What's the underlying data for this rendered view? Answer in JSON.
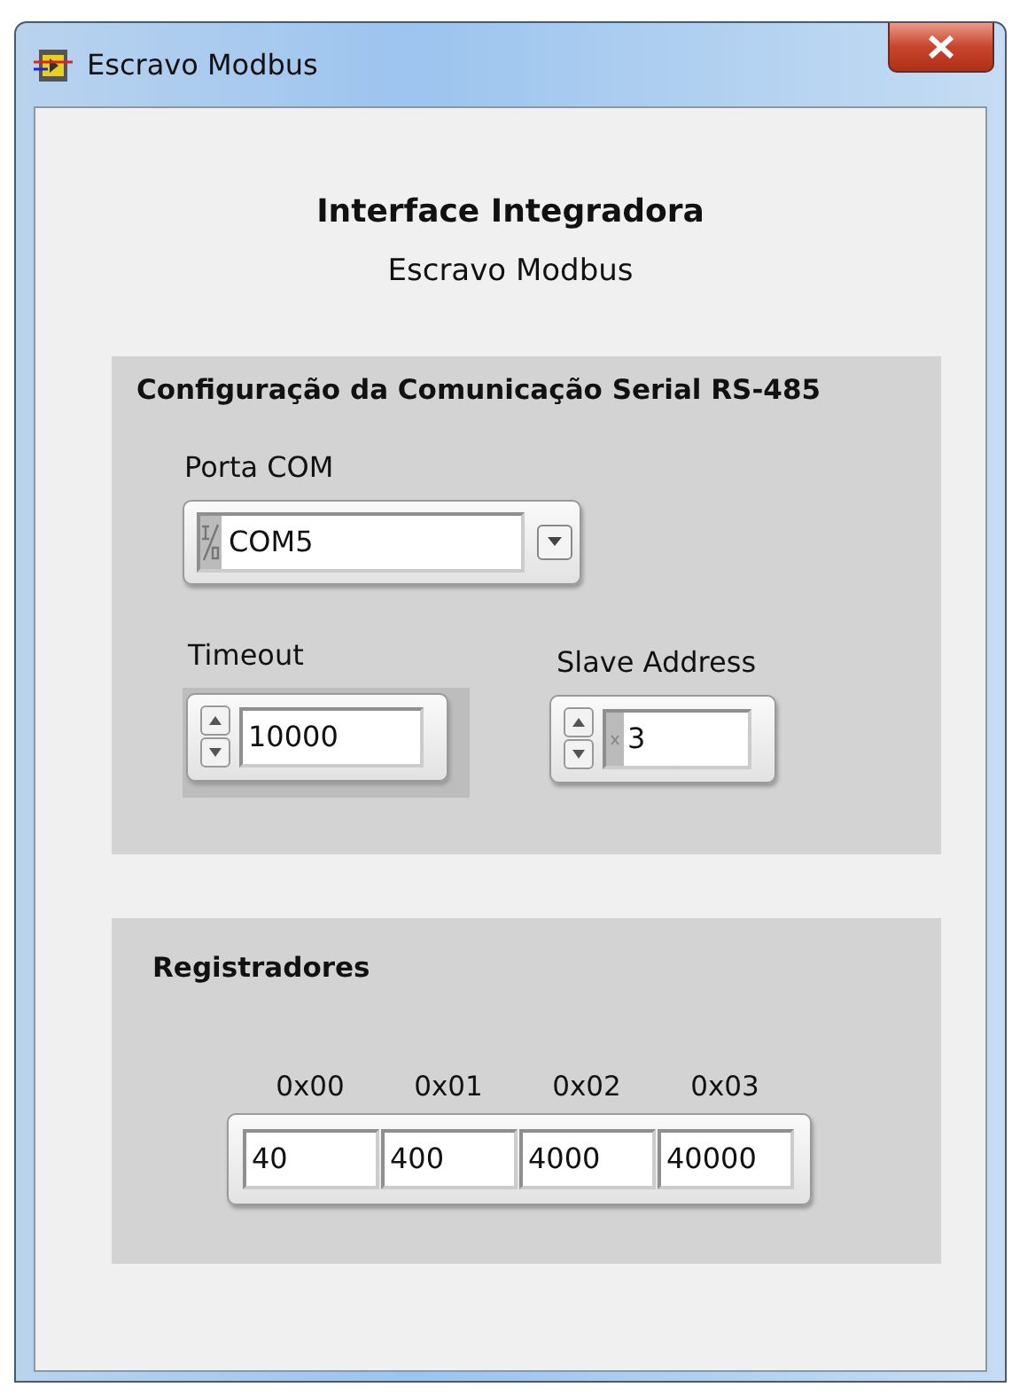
{
  "window": {
    "title": "Escravo Modbus"
  },
  "header": {
    "title": "Interface Integradora",
    "subtitle": "Escravo Modbus"
  },
  "serial_config": {
    "title": "Configuração da Comunicação Serial RS-485",
    "port": {
      "label": "Porta COM",
      "value": "COM5"
    },
    "timeout": {
      "label": "Timeout",
      "value": "10000"
    },
    "slave_address": {
      "label": "Slave Address",
      "value": "3"
    }
  },
  "registers": {
    "title": "Registradores",
    "items": [
      {
        "label": "0x00",
        "value": "40"
      },
      {
        "label": "0x01",
        "value": "400"
      },
      {
        "label": "0x02",
        "value": "4000"
      },
      {
        "label": "0x03",
        "value": "40000"
      }
    ]
  }
}
